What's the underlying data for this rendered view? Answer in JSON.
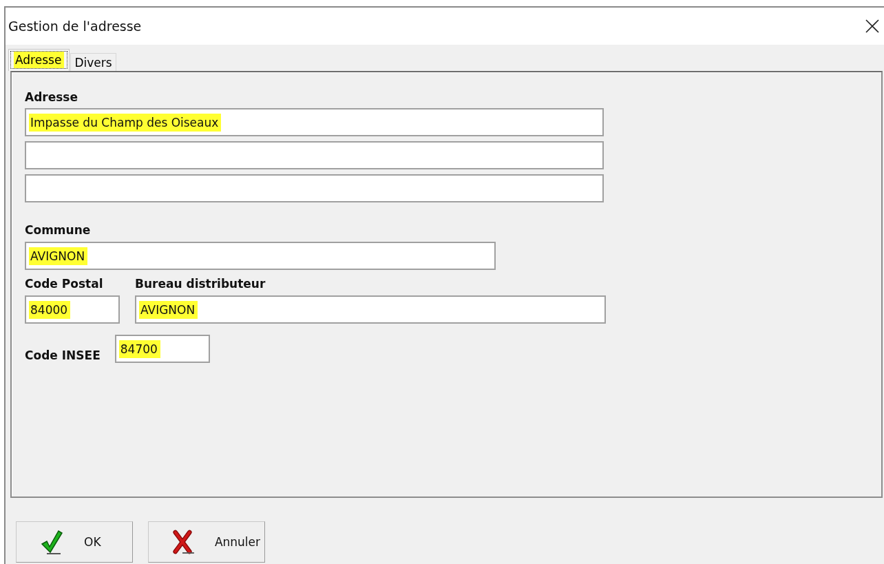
{
  "window": {
    "title": "Gestion de l'adresse"
  },
  "tabs": [
    {
      "label": "Adresse",
      "selected": true,
      "highlighted": true
    },
    {
      "label": "Divers",
      "selected": false,
      "highlighted": false
    }
  ],
  "address": {
    "label": "Adresse",
    "lines": [
      {
        "kind": "filled",
        "value": "Impasse du Champ des Oiseaux",
        "highlighted": true
      },
      {
        "kind": "blank"
      },
      {
        "kind": "blank"
      }
    ]
  },
  "commune": {
    "label": "Commune",
    "value": "AVIGNON",
    "highlighted": true
  },
  "postal_code": {
    "label": "Code Postal",
    "value": "84000",
    "highlighted": true
  },
  "distribution_office": {
    "label": "Bureau distributeur",
    "value": "AVIGNON",
    "highlighted": true
  },
  "insee_code": {
    "label": "Code INSEE",
    "value": "84700",
    "highlighted": true
  },
  "buttons": [
    {
      "kind": "ok",
      "label": "OK"
    },
    {
      "kind": "cancel",
      "label": "Annuler"
    }
  ]
}
